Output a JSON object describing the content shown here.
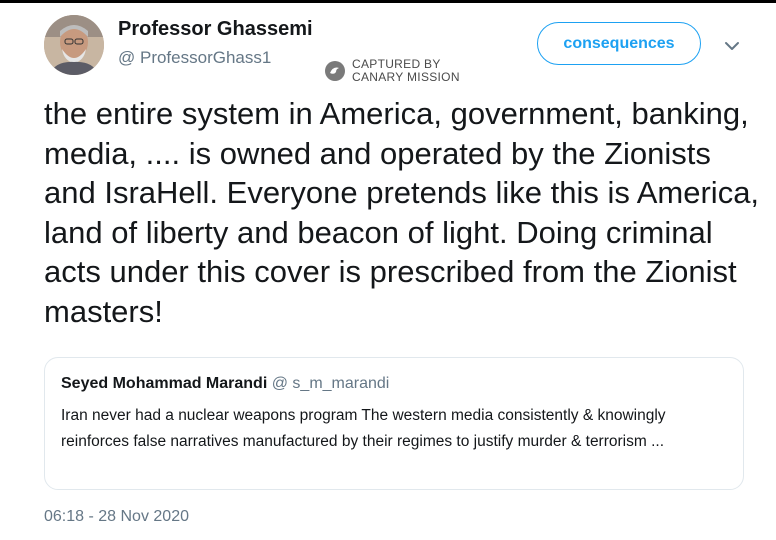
{
  "tweet": {
    "author": {
      "display_name": "Professor Ghassemi",
      "handle": "@ ProfessorGhass1",
      "avatar_icon": "person-avatar"
    },
    "follow_button_label": "consequences",
    "menu_icon": "chevron-down-icon",
    "text": "the entire system in America, government, banking, media, .... is owned and operated by the Zionists and IsraHell. Everyone pretends like this is America, land of liberty and beacon of light. Doing criminal acts under this cover is prescribed from the Zionist masters!",
    "timestamp": "06:18 - 28 Nov 2020",
    "quoted": {
      "author_name": "Seyed Mohammad Marandi",
      "author_handle": "@ s_m_marandi",
      "text": "Iran never had a nuclear weapons program The western media consistently & knowingly reinforces false narratives manufactured by their regimes to justify murder & terrorism ..."
    }
  },
  "watermark": {
    "line1": "CAPTURED BY",
    "line2": "CANARY MISSION"
  },
  "colors": {
    "accent": "#1da1f2",
    "secondary_text": "#657786",
    "primary_text": "#14171a",
    "card_border": "#e1e8ed"
  }
}
